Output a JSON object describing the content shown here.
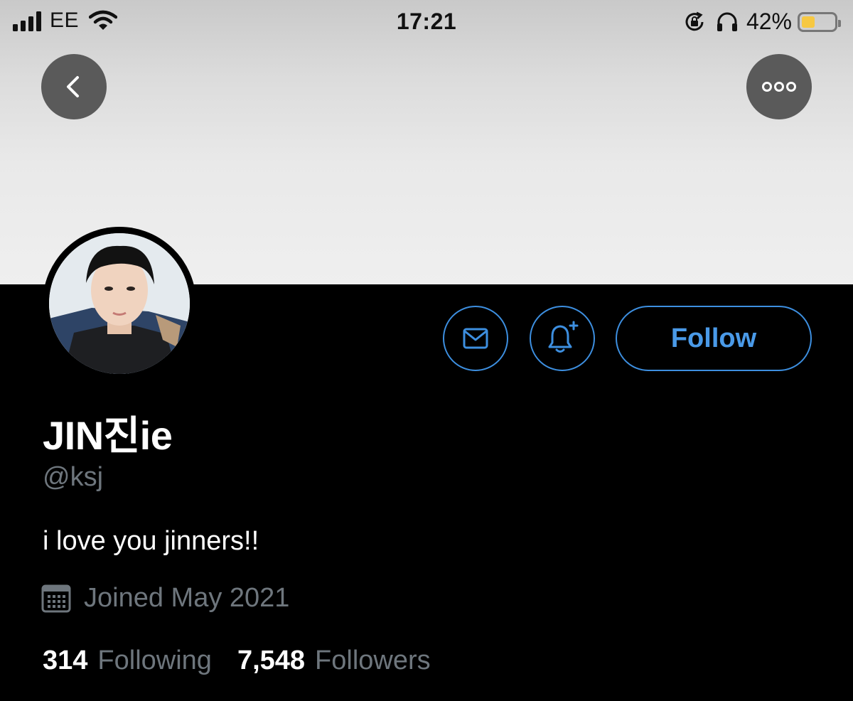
{
  "status_bar": {
    "carrier": "EE",
    "time": "17:21",
    "battery_percent": "42%",
    "battery_level": 0.42,
    "icons": [
      "signal-icon",
      "wifi-icon",
      "rotation-lock-icon",
      "headphones-icon",
      "battery-icon"
    ]
  },
  "header": {
    "back_icon": "chevron-left-icon",
    "more_icon": "more-horizontal-icon"
  },
  "actions": {
    "message_icon": "envelope-icon",
    "notify_icon": "bell-plus-icon",
    "follow_label": "Follow"
  },
  "profile": {
    "display_name": "JIN진ie",
    "handle": "@ksj",
    "bio": "i love you jinners!!",
    "joined": "Joined May 2021",
    "following_count": "314",
    "following_label": "Following",
    "followers_count": "7,548",
    "followers_label": "Followers"
  },
  "colors": {
    "accent": "#3d8fe0",
    "background": "#000000",
    "muted_text": "#6e767d",
    "banner": "#efefef"
  }
}
